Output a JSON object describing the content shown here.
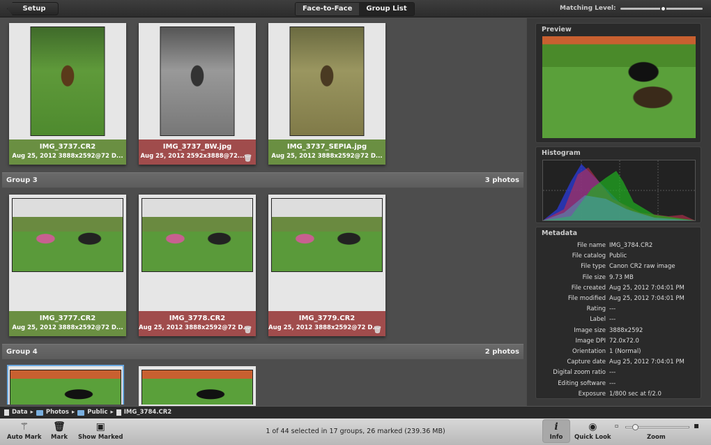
{
  "topbar": {
    "setup": "Setup",
    "tabs": [
      "Face-to-Face",
      "Group List"
    ],
    "matching_label": "Matching Level:",
    "matching_value": 0.55
  },
  "rows": [
    {
      "cards": [
        {
          "name": "IMG_3737.CR2",
          "detail": "Aug 25, 2012  3888x2592@72 D...",
          "status": "kept",
          "img": "img-color",
          "orient": "port"
        },
        {
          "name": "IMG_3737_BW.jpg",
          "detail": "Aug 25, 2012  2592x3888@72...",
          "status": "marked",
          "img": "img-bw",
          "orient": "port"
        },
        {
          "name": "IMG_3737_SEPIA.jpg",
          "detail": "Aug 25, 2012  3888x2592@72 D...",
          "status": "kept",
          "img": "img-sepia",
          "orient": "port"
        }
      ]
    },
    {
      "cards": [
        {
          "name": "IMG_3777.CR2",
          "detail": "Aug 25, 2012  3888x2592@72 D...",
          "status": "kept",
          "img": "img-group",
          "orient": "land"
        },
        {
          "name": "IMG_3778.CR2",
          "detail": "Aug 25, 2012  3888x2592@72 D...",
          "status": "marked",
          "img": "img-group",
          "orient": "land"
        },
        {
          "name": "IMG_3779.CR2",
          "detail": "Aug 25, 2012  3888x2592@72 D...",
          "status": "marked",
          "img": "img-group",
          "orient": "land"
        }
      ]
    }
  ],
  "groups": [
    {
      "name": "Group 3",
      "count": "3 photos"
    },
    {
      "name": "Group 4",
      "count": "2 photos"
    }
  ],
  "panel": {
    "preview": "Preview",
    "histogram": "Histogram",
    "metadata": "Metadata",
    "meta": [
      [
        "File name",
        "IMG_3784.CR2"
      ],
      [
        "File catalog",
        "Public"
      ],
      [
        "File type",
        "Canon CR2 raw image"
      ],
      [
        "File size",
        "9.73 MB"
      ],
      [
        "File created",
        "Aug 25, 2012 7:04:01 PM"
      ],
      [
        "File modified",
        "Aug 25, 2012 7:04:01 PM"
      ],
      [
        "Rating",
        "---"
      ],
      [
        "Label",
        "---"
      ],
      [
        "Image size",
        "3888x2592"
      ],
      [
        "Image DPI",
        "72.0x72.0"
      ],
      [
        "Orientation",
        "1 (Normal)"
      ],
      [
        "Capture date",
        "Aug 25, 2012 7:04:01 PM"
      ],
      [
        "Digital zoom ratio",
        "---"
      ],
      [
        "Editing software",
        "---"
      ],
      [
        "Exposure",
        "1/800 sec at f/2.0"
      ]
    ]
  },
  "breadcrumb": [
    "Data",
    "Photos",
    "Public",
    "IMG_3784.CR2"
  ],
  "toolbar": {
    "auto_mark": "Auto Mark",
    "mark": "Mark",
    "show_marked": "Show Marked",
    "status": "1 of 44 selected in 17 groups, 26 marked (239.36 MB)",
    "info": "Info",
    "quick_look": "Quick Look",
    "zoom": "Zoom",
    "zoom_value": 0.15
  },
  "colors": {
    "kept": "#6a8f42",
    "marked": "#a04c4c"
  }
}
